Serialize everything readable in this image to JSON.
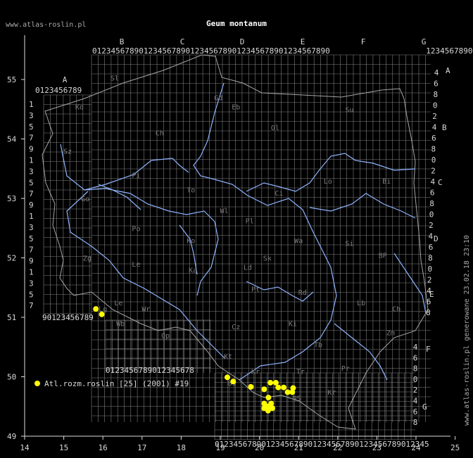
{
  "title": "Geum montanum",
  "site": "www.atlas-roslin.pl",
  "generated_note": "www.atlas-roslin.pl generowane 23.02.18 23:10",
  "legend": {
    "label": "Atl.rozm.roslin [25] (2001) #19",
    "color": "#ffff00"
  },
  "colors": {
    "background": "#000000",
    "grid": "#808080",
    "border": "#b0b0b0",
    "river": "#8fb4ff",
    "axis": "#dddddd",
    "point": "#ffff00"
  },
  "axes": {
    "x": {
      "ticks": [
        "14",
        "15",
        "16",
        "17",
        "18",
        "19",
        "20",
        "21",
        "22",
        "23",
        "24",
        "25"
      ],
      "range": [
        14,
        25
      ]
    },
    "y": {
      "ticks": [
        "49",
        "50",
        "51",
        "52",
        "53",
        "54",
        "55"
      ],
      "range": [
        49,
        55.7
      ]
    }
  },
  "grid_labels": {
    "top_letters": [
      "B",
      "C",
      "D",
      "E",
      "F",
      "G"
    ],
    "top_digits": "0123456789012345678901234567890123456789012345678901234567890123456789012345678",
    "a_letter": "A",
    "a_digits": "0123456789",
    "left_digits": [
      "1",
      "3",
      "5",
      "7",
      "9",
      "1",
      "3",
      "5",
      "7",
      "9",
      "1",
      "3",
      "5",
      "7",
      "9",
      "1",
      "3",
      "5",
      "7"
    ],
    "bottom_left_digits": "90123456789",
    "bottom_mid_digits": "0123456789012345678",
    "bottom_right_digits": "0123456789012345678901234567890123456789012345",
    "right_letters": [
      "A",
      "B",
      "C",
      "D",
      "E",
      "F",
      "G"
    ],
    "right_digits": [
      "4",
      "6",
      "8",
      "0",
      "2",
      "4",
      "6",
      "8",
      "0",
      "2",
      "4",
      "6",
      "8",
      "0",
      "2",
      "4",
      "6",
      "8",
      "0",
      "2",
      "4",
      "6",
      "8"
    ],
    "f_digits": [
      "4",
      "6",
      "8",
      "0",
      "2",
      "4",
      "6",
      "8"
    ]
  },
  "region_codes": [
    {
      "code": "Sl",
      "lon": 16.3,
      "lat": 54.98
    },
    {
      "code": "Ko",
      "lon": 15.4,
      "lat": 54.5
    },
    {
      "code": "Gd",
      "lon": 18.95,
      "lat": 54.65
    },
    {
      "code": "Eb",
      "lon": 19.4,
      "lat": 54.5
    },
    {
      "code": "Su",
      "lon": 22.3,
      "lat": 54.45
    },
    {
      "code": "Ch",
      "lon": 17.45,
      "lat": 54.06
    },
    {
      "code": "Ol",
      "lon": 20.4,
      "lat": 54.15
    },
    {
      "code": "Pi",
      "lon": 16.85,
      "lat": 53.35
    },
    {
      "code": "To",
      "lon": 18.25,
      "lat": 53.1
    },
    {
      "code": "Ci",
      "lon": 20.5,
      "lat": 53.05
    },
    {
      "code": "Lo",
      "lon": 21.75,
      "lat": 53.25
    },
    {
      "code": "Bi",
      "lon": 23.25,
      "lat": 53.25
    },
    {
      "code": "Sz",
      "lon": 15.1,
      "lat": 53.75
    },
    {
      "code": "Go",
      "lon": 15.55,
      "lat": 52.95
    },
    {
      "code": "Wl",
      "lon": 19.1,
      "lat": 52.75
    },
    {
      "code": "Pl",
      "lon": 19.75,
      "lat": 52.58
    },
    {
      "code": "Po",
      "lon": 16.85,
      "lat": 52.45
    },
    {
      "code": "Ko",
      "lon": 18.25,
      "lat": 52.25
    },
    {
      "code": "Wa",
      "lon": 21.0,
      "lat": 52.25
    },
    {
      "code": "Si",
      "lon": 22.3,
      "lat": 52.2
    },
    {
      "code": "BP",
      "lon": 23.15,
      "lat": 52.0
    },
    {
      "code": "Zg",
      "lon": 15.6,
      "lat": 51.95
    },
    {
      "code": "Le",
      "lon": 16.85,
      "lat": 51.85
    },
    {
      "code": "Ka",
      "lon": 18.3,
      "lat": 51.75
    },
    {
      "code": "Ld",
      "lon": 19.7,
      "lat": 51.8
    },
    {
      "code": "Sk",
      "lon": 20.2,
      "lat": 51.95
    },
    {
      "code": "Pt",
      "lon": 19.9,
      "lat": 51.43
    },
    {
      "code": "Rd",
      "lon": 21.1,
      "lat": 51.38
    },
    {
      "code": "Lb",
      "lon": 22.6,
      "lat": 51.2
    },
    {
      "code": "Le",
      "lon": 16.4,
      "lat": 51.2
    },
    {
      "code": "Wr",
      "lon": 17.1,
      "lat": 51.1
    },
    {
      "code": "Ch",
      "lon": 23.5,
      "lat": 51.1
    },
    {
      "code": "Wb",
      "lon": 16.45,
      "lat": 50.85
    },
    {
      "code": "Cz",
      "lon": 19.4,
      "lat": 50.8
    },
    {
      "code": "Ki",
      "lon": 20.85,
      "lat": 50.85
    },
    {
      "code": "Zm",
      "lon": 23.35,
      "lat": 50.7
    },
    {
      "code": "Lg",
      "lon": 16.0,
      "lat": 51.1
    },
    {
      "code": "Op",
      "lon": 17.6,
      "lat": 50.65
    },
    {
      "code": "Kt",
      "lon": 19.2,
      "lat": 50.3
    },
    {
      "code": "Tb",
      "lon": 21.5,
      "lat": 50.5
    },
    {
      "code": "Tr",
      "lon": 21.05,
      "lat": 50.05
    },
    {
      "code": "Pr",
      "lon": 22.2,
      "lat": 50.1
    },
    {
      "code": "Kr",
      "lon": 19.9,
      "lat": 50.05
    },
    {
      "code": "Bs",
      "lon": 19.3,
      "lat": 49.85
    },
    {
      "code": "NS",
      "lon": 20.95,
      "lat": 49.6
    },
    {
      "code": "Kr",
      "lon": 21.85,
      "lat": 49.7
    }
  ],
  "occurrences": [
    {
      "lon": 15.82,
      "lat": 51.14
    },
    {
      "lon": 15.97,
      "lat": 51.05
    },
    {
      "lon": 19.18,
      "lat": 49.99
    },
    {
      "lon": 19.33,
      "lat": 49.92
    },
    {
      "lon": 19.78,
      "lat": 49.83
    },
    {
      "lon": 20.12,
      "lat": 49.79
    },
    {
      "lon": 20.28,
      "lat": 49.9
    },
    {
      "lon": 20.42,
      "lat": 49.9
    },
    {
      "lon": 20.48,
      "lat": 49.82
    },
    {
      "lon": 20.62,
      "lat": 49.82
    },
    {
      "lon": 20.86,
      "lat": 49.81
    },
    {
      "lon": 20.72,
      "lat": 49.74
    },
    {
      "lon": 20.84,
      "lat": 49.74
    },
    {
      "lon": 20.23,
      "lat": 49.65
    },
    {
      "lon": 20.12,
      "lat": 49.55
    },
    {
      "lon": 20.12,
      "lat": 49.47
    },
    {
      "lon": 20.22,
      "lat": 49.5
    },
    {
      "lon": 20.3,
      "lat": 49.55
    },
    {
      "lon": 20.33,
      "lat": 49.47
    },
    {
      "lon": 20.22,
      "lat": 49.43
    }
  ]
}
